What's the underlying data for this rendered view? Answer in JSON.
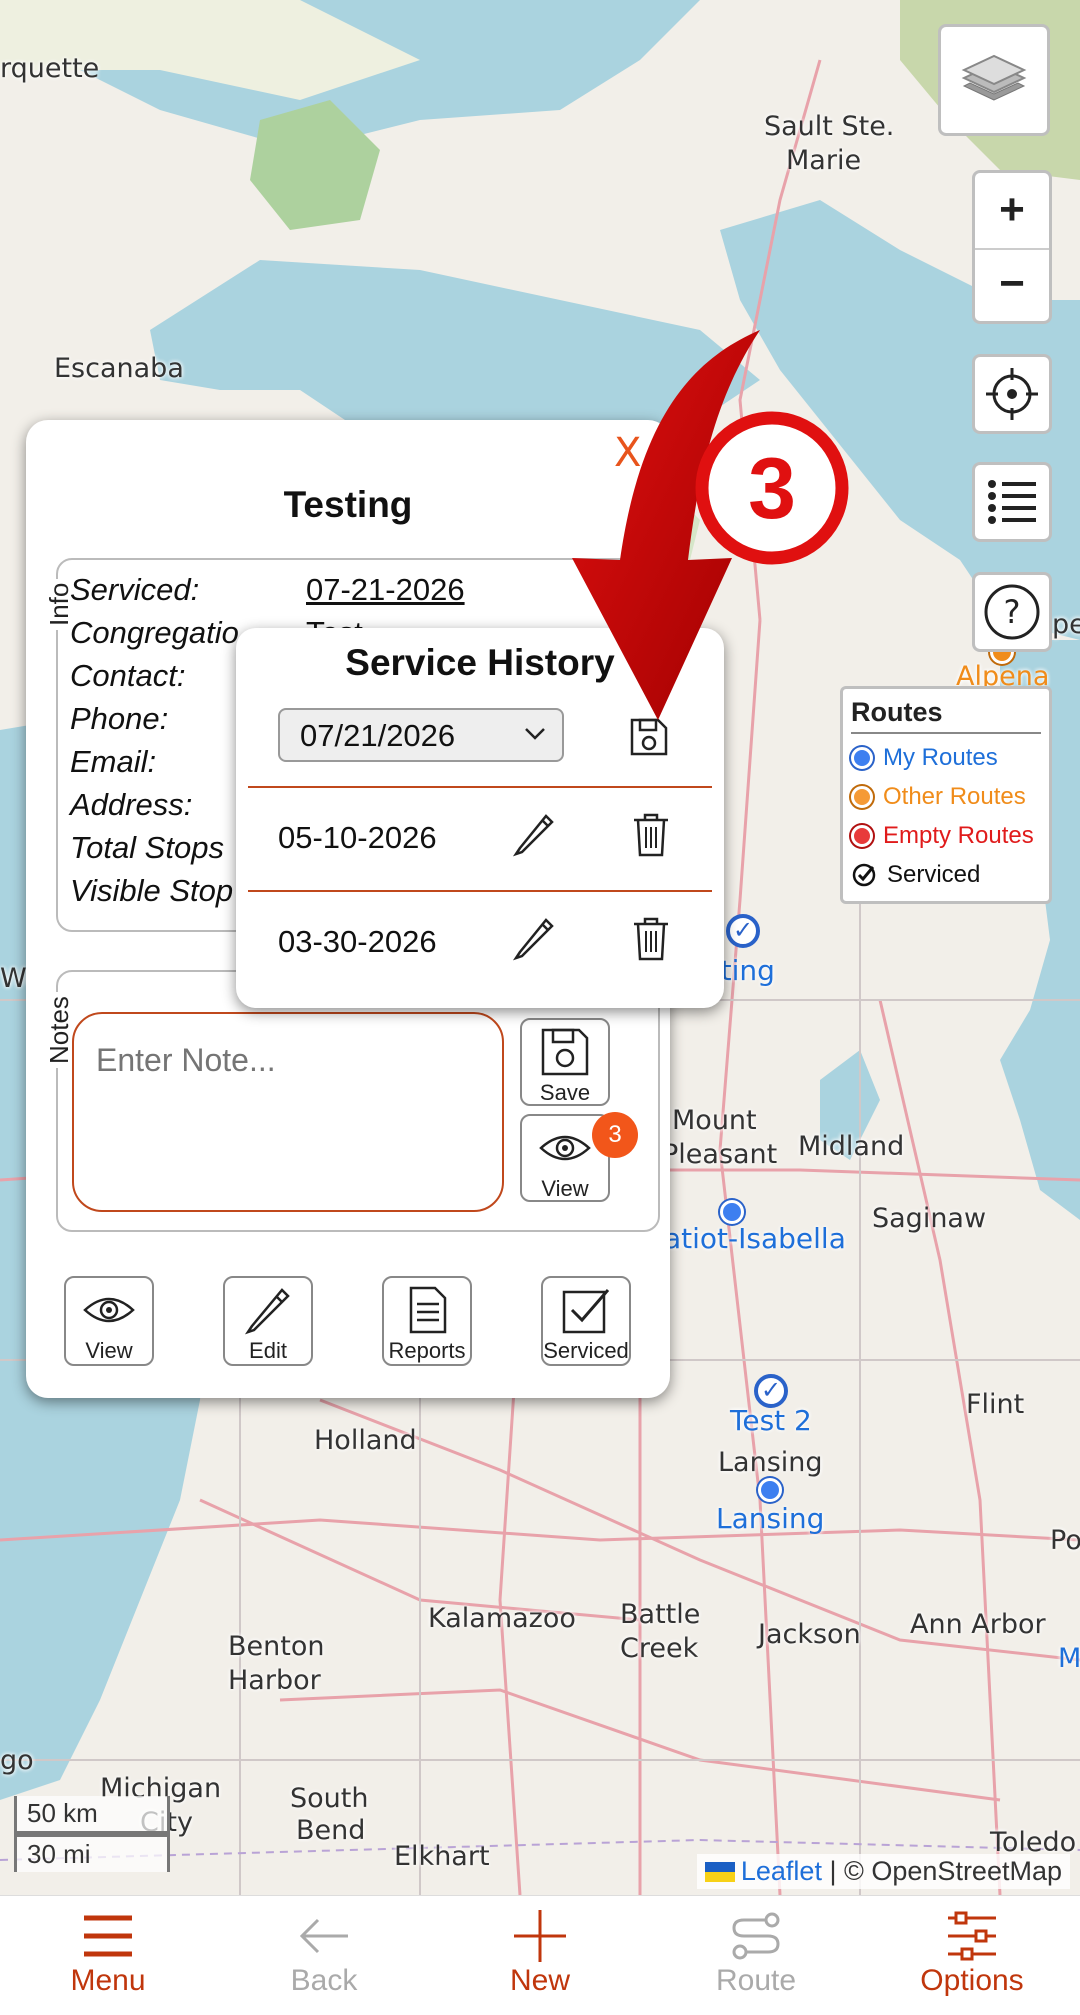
{
  "map": {
    "cities": [
      {
        "name": "rquette"
      },
      {
        "name": "Sault Ste."
      },
      {
        "name": "Marie"
      },
      {
        "name": "Escanaba"
      },
      {
        "name": "Alpena"
      },
      {
        "name": "Mount"
      },
      {
        "name": "Pleasant"
      },
      {
        "name": "Midland"
      },
      {
        "name": "Saginaw"
      },
      {
        "name": "Flint"
      },
      {
        "name": "Holland"
      },
      {
        "name": "Lansing"
      },
      {
        "name": "Kalamazoo"
      },
      {
        "name": "Battle"
      },
      {
        "name": "Creek"
      },
      {
        "name": "Jackson"
      },
      {
        "name": "Ann Arbor"
      },
      {
        "name": "Benton"
      },
      {
        "name": "Harbor"
      },
      {
        "name": "Michigan"
      },
      {
        "name": "City"
      },
      {
        "name": "South"
      },
      {
        "name": "Bend"
      },
      {
        "name": "Elkhart"
      },
      {
        "name": "Toledo"
      },
      {
        "name": "go"
      },
      {
        "name": "Po"
      },
      {
        "name": "M"
      },
      {
        "name": "Wo"
      },
      {
        "name": "pe"
      }
    ],
    "pins": [
      {
        "label": "sting"
      },
      {
        "label": "atiot-Isabella"
      },
      {
        "label": "Test 2"
      },
      {
        "label": "Lansing"
      }
    ],
    "scale_km": "50 km",
    "scale_mi": "30 mi",
    "attribution_link": "Leaflet",
    "attribution_text": "| © OpenStreetMap"
  },
  "legend": {
    "title": "Routes",
    "items": [
      {
        "label": "My Routes",
        "color": "#1e6fd9"
      },
      {
        "label": "Other Routes",
        "color": "#f08c1a"
      },
      {
        "label": "Empty Routes",
        "color": "#e01b1b"
      },
      {
        "label": "Serviced",
        "color": "#111111"
      }
    ]
  },
  "card": {
    "close": "X",
    "title": "Testing",
    "info_label": "Info",
    "fields": [
      {
        "label": "Serviced:",
        "value": "07-21-2026"
      },
      {
        "label": "Congregatio",
        "value": "Test"
      },
      {
        "label": "Contact:",
        "value": ""
      },
      {
        "label": "Phone:",
        "value": ""
      },
      {
        "label": "Email:",
        "value": ""
      },
      {
        "label": "Address:",
        "value": ""
      },
      {
        "label": "Total Stops",
        "value": ""
      },
      {
        "label": "Visible Stop",
        "value": ""
      }
    ],
    "notes_label": "Notes",
    "note_placeholder": "Enter Note...",
    "save_label": "Save",
    "view_label": "View",
    "notes_count": "3",
    "actions": [
      {
        "label": "View",
        "icon": "eye-icon"
      },
      {
        "label": "Edit",
        "icon": "pencil-icon"
      },
      {
        "label": "Reports",
        "icon": "document-icon"
      },
      {
        "label": "Serviced",
        "icon": "checkbox-icon"
      }
    ]
  },
  "history": {
    "title": "Service History",
    "date_value": "07/21/2026",
    "entries": [
      {
        "date": "05-10-2026"
      },
      {
        "date": "03-30-2026"
      }
    ]
  },
  "annotation": {
    "step_number": "3",
    "color": "#e01010"
  },
  "nav": {
    "items": [
      {
        "label": "Menu",
        "icon": "hamburger-icon",
        "enabled": true
      },
      {
        "label": "Back",
        "icon": "back-arrow-icon",
        "enabled": false
      },
      {
        "label": "New",
        "icon": "plus-icon",
        "enabled": true
      },
      {
        "label": "Route",
        "icon": "route-icon",
        "enabled": false
      },
      {
        "label": "Options",
        "icon": "sliders-icon",
        "enabled": true
      }
    ]
  }
}
